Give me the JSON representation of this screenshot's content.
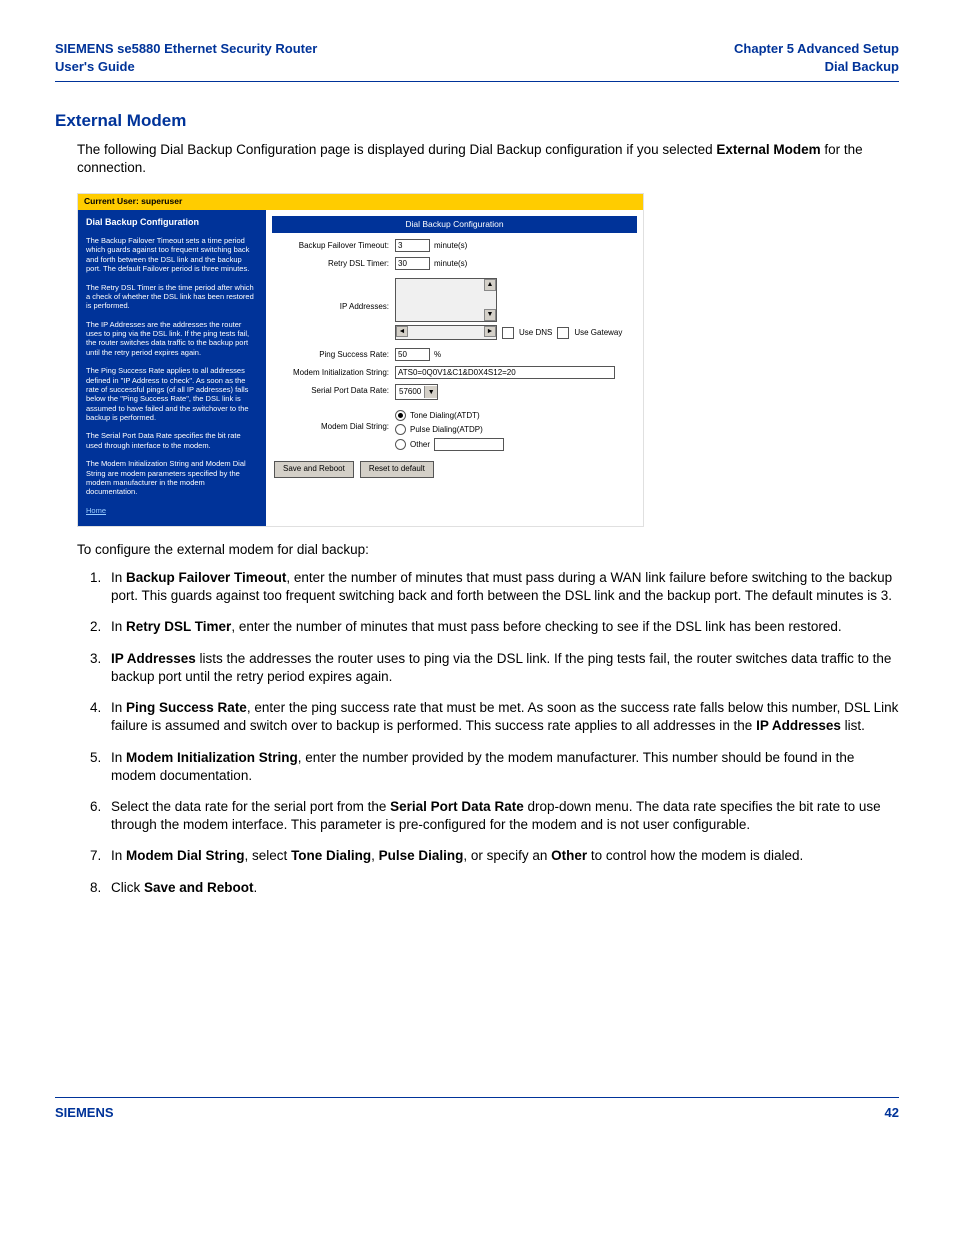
{
  "header": {
    "left_line1": "SIEMENS se5880 Ethernet Security Router",
    "left_line2": "User's Guide",
    "right_line1": "Chapter 5  Advanced Setup",
    "right_line2": "Dial Backup"
  },
  "section_title": "External Modem",
  "intro_before_bold": "The following Dial Backup Configuration page is displayed during Dial Backup configuration if you selected ",
  "intro_bold": "External Modem",
  "intro_after_bold": " for the connection.",
  "screenshot": {
    "topbar": "Current User: superuser",
    "left_title": "Dial Backup Configuration",
    "left_paras": [
      "The Backup Failover Timeout sets a time period which guards against too frequent switching back and forth between the DSL link and the backup port. The default Failover period is three minutes.",
      "The Retry DSL Timer is the time period after which a check of whether the DSL link has been restored is performed.",
      "The IP Addresses are the addresses the router uses to ping via the DSL link. If the ping tests fail, the router switches data traffic to the backup port until the retry period expires again.",
      "The Ping Success Rate applies to all addresses defined in \"IP Address to check\". As soon as the rate of successful pings (of all IP addresses) falls below the \"Ping Success Rate\", the DSL link is assumed to have failed and the switchover to the backup is performed.",
      "The Serial Port Data Rate specifies the bit rate used through interface to the modem.",
      "The Modem Initialization String and Modem Dial String are modem parameters specified by the modem manufacturer in the modem documentation."
    ],
    "home_link": "Home",
    "right_title": "Dial Backup Configuration",
    "fields": {
      "failover_label": "Backup Failover Timeout:",
      "failover_value": "3",
      "failover_unit": "minute(s)",
      "retry_label": "Retry DSL Timer:",
      "retry_value": "30",
      "retry_unit": "minute(s)",
      "ip_label": "IP Addresses:",
      "use_dns": "Use DNS",
      "use_gateway": "Use Gateway",
      "ping_label": "Ping Success Rate:",
      "ping_value": "50",
      "ping_unit": "%",
      "init_label": "Modem Initialization String:",
      "init_value": "ATS0=0Q0V1&C1&D0X4S12=20",
      "rate_label": "Serial Port Data Rate:",
      "rate_value": "57600",
      "dial_label": "Modem Dial String:",
      "dial_tone": "Tone Dialing(ATDT)",
      "dial_pulse": "Pulse Dialing(ATDP)",
      "dial_other": "Other",
      "save_btn": "Save and Reboot",
      "reset_btn": "Reset to default"
    }
  },
  "after_screenshot": "To configure the external modem for dial backup:",
  "steps": [
    {
      "pre": "In ",
      "b1": "Backup Failover Timeout",
      "post": ", enter the number of minutes that must pass during a WAN link failure before switching to the backup port. This guards against too frequent switching back and forth between the DSL link and the backup port. The default minutes is 3."
    },
    {
      "pre": "In ",
      "b1": "Retry DSL Timer",
      "post": ", enter the number of minutes that must pass before checking to see if the DSL link has been restored."
    },
    {
      "pre": "",
      "b1": "IP Addresses",
      "post": " lists the addresses the router uses to ping via the DSL link. If the ping tests fail, the router switches data traffic to the backup port until the retry period expires again."
    },
    {
      "pre": "In ",
      "b1": "Ping Success Rate",
      "mid1": ", enter the ping success rate that must be met. As soon as the success rate falls below this number, DSL Link failure is assumed and switch over to backup is performed. This success rate applies to all addresses in the ",
      "b2": "IP Addresses",
      "post": " list."
    },
    {
      "pre": "In ",
      "b1": "Modem Initialization String",
      "post": ", enter the number provided by the modem manufacturer. This number should be found in the modem documentation."
    },
    {
      "pre": "Select the data rate for the serial port from the ",
      "b1": "Serial Port Data Rate",
      "post": " drop-down menu. The data rate specifies the bit rate to use through the modem interface. This parameter is pre-configured for the modem and is not user configurable."
    },
    {
      "pre": "In ",
      "b1": "Modem Dial String",
      "mid1": ", select ",
      "b2": "Tone Dialing",
      "mid2": ", ",
      "b3": "Pulse Dialing",
      "mid3": ", or specify an ",
      "b4": "Other",
      "post": " to control how the modem is dialed."
    },
    {
      "pre": "Click ",
      "b1": "Save and Reboot",
      "post": "."
    }
  ],
  "footer": {
    "left": "SIEMENS",
    "right": "42"
  }
}
